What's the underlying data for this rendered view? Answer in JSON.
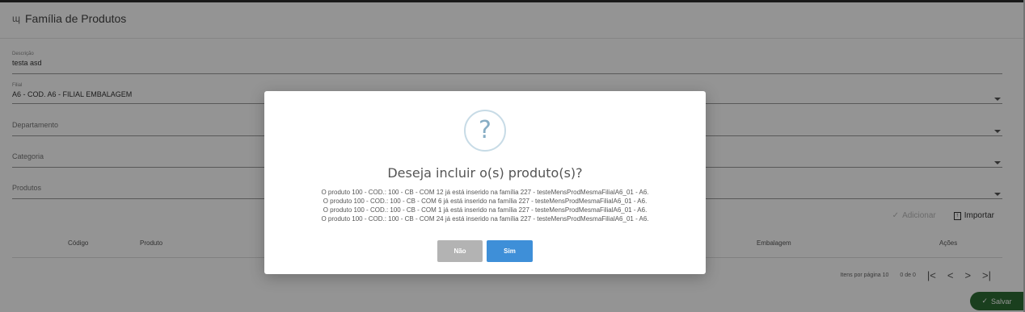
{
  "header": {
    "title": "Família de Produtos",
    "icon": "basket-icon"
  },
  "form": {
    "descricao": {
      "label": "Descrição",
      "value": "testa asd"
    },
    "filial": {
      "label": "Filial",
      "value": "A6 - COD. A6 - FILIAL EMBALAGEM"
    },
    "departamento": {
      "placeholder": "Departamento"
    },
    "categoria": {
      "placeholder": "Categoria"
    },
    "produtos": {
      "placeholder": "Produtos"
    }
  },
  "actions": {
    "add_label": "Adicionar",
    "import_label": "Importar"
  },
  "table": {
    "columns": [
      "Código",
      "Produto",
      "Embalagem",
      "Ações"
    ]
  },
  "pager": {
    "items_per_page_label": "Itens por página",
    "items_per_page": "10",
    "range": "0 de 0",
    "first": "|<",
    "prev": "<",
    "next": ">",
    "last": ">|"
  },
  "save_button": {
    "label": "Salvar"
  },
  "dialog": {
    "icon_glyph": "?",
    "title": "Deseja incluir o(s) produto(s)?",
    "messages": [
      "O produto 100 - COD.: 100 - CB - COM 12 já está inserido na família 227 - testeMensProdMesmaFilialA6_01 - A6.",
      "O produto 100 - COD.: 100 - CB - COM 6 já está inserido na família 227 - testeMensProdMesmaFilialA6_01 - A6.",
      "O produto 100 - COD.: 100 - CB - COM 1 já está inserido na família 227 - testeMensProdMesmaFilialA6_01 - A6.",
      "O produto 100 - COD.: 100 - CB - COM 24 já está inserido na família 227 - testeMensProdMesmaFilialA6_01 - A6."
    ],
    "no_label": "Não",
    "yes_label": "Sim"
  },
  "colors": {
    "primary": "#3e8fd8",
    "secondary": "#b3b3b3",
    "save": "#2e6d34",
    "question_icon": "#87adc4"
  }
}
